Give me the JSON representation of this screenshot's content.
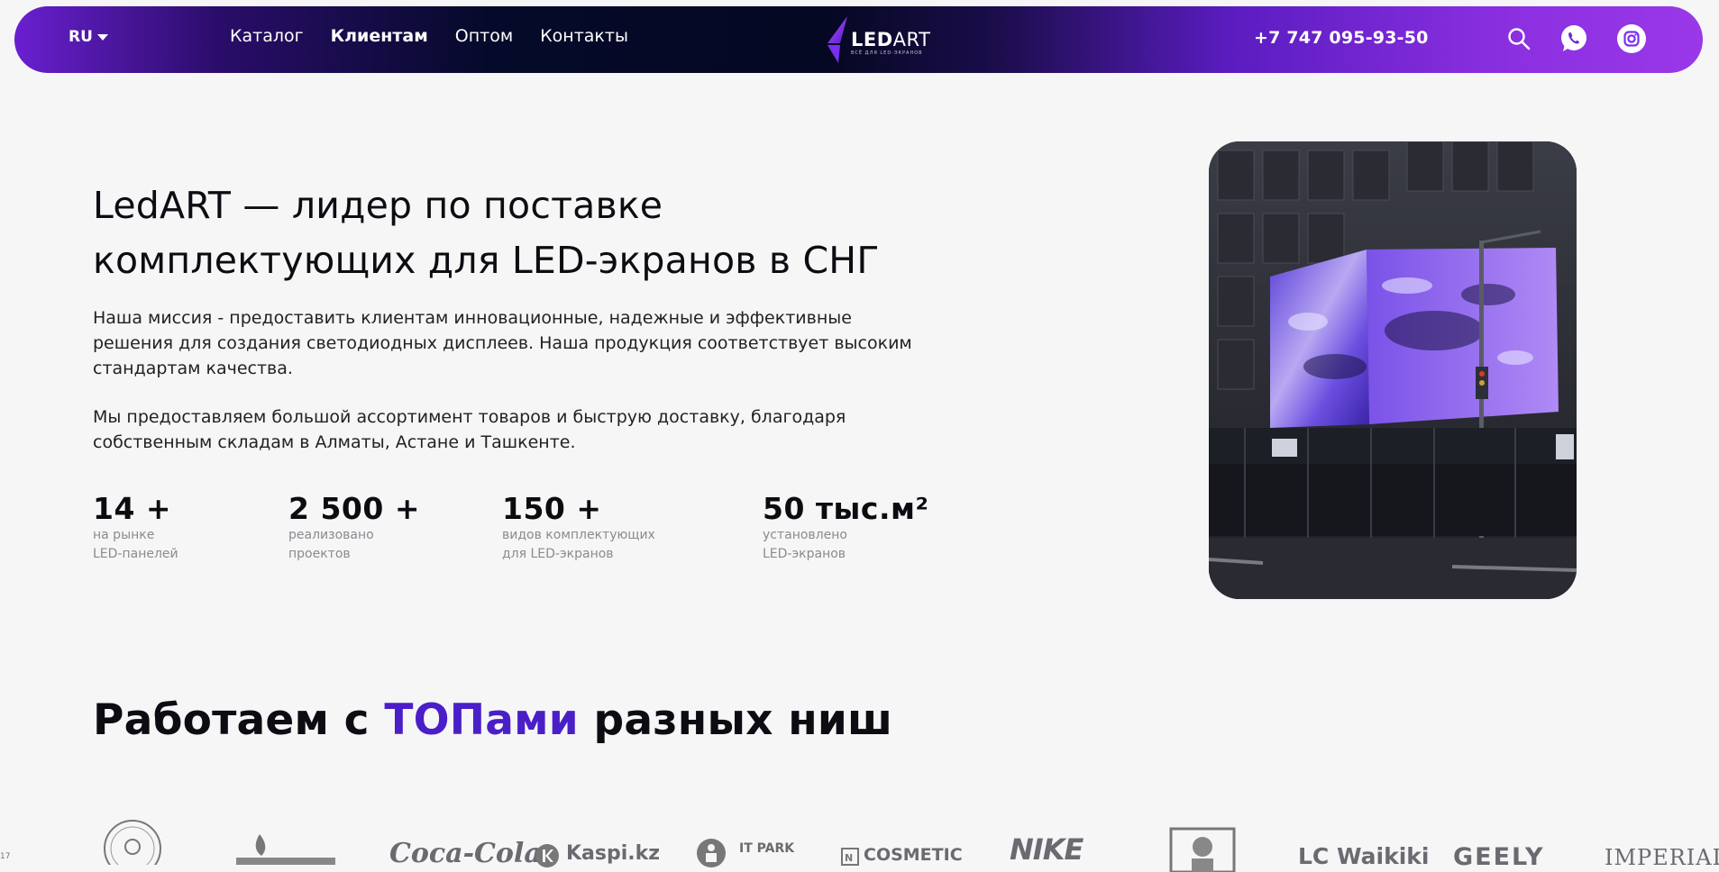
{
  "header": {
    "lang": "RU",
    "nav": [
      "Каталог",
      "Клиентам",
      "Оптом",
      "Контакты"
    ],
    "logo_text_led": "LED",
    "logo_text_art": "ART",
    "logo_tagline": "ВСЁ ДЛЯ LED-ЭКРАНОВ",
    "phone": "+7 747 095-93-50"
  },
  "hero": {
    "title_line1": "LedART — лидер по поставке",
    "title_line2": "комплектующих для LED-экранов в СНГ",
    "p1": "Наша миссия - предоставить клиентам инновационные, надежные и эффективные решения для создания светодиодных дисплеев. Наша продукция соответствует высоким стандартам качества.",
    "p2": "Мы предоставляем большой ассортимент товаров и быструю доставку, благодаря собственным складам в Алматы, Астане и Ташкенте.",
    "stats": [
      {
        "value": "14 +",
        "line1": "на рынке",
        "line2": "LED-панелей"
      },
      {
        "value": "2 500 +",
        "line1": "реализовано",
        "line2": "проектов"
      },
      {
        "value": "150 +",
        "line1": "видов комплектующих",
        "line2": "для LED-экранов"
      },
      {
        "value": "50 тыс.м²",
        "line1": "установлено",
        "line2": "LED-экранов"
      }
    ]
  },
  "partners": {
    "title_pre": "Работаем с ",
    "title_accent": "ТОПами",
    "title_post": " разных ниш",
    "logos": [
      "Coca-Cola",
      "Kaspi.kz",
      "IT PARK",
      "COSMETIC",
      "NIKE",
      "LC Waikiki",
      "GEELY",
      "IMPERIAL"
    ],
    "edge_number": "17"
  },
  "colors": {
    "accent": "#4a1fc8",
    "header_left": "#6a1fd0",
    "header_right": "#9a38e8"
  }
}
